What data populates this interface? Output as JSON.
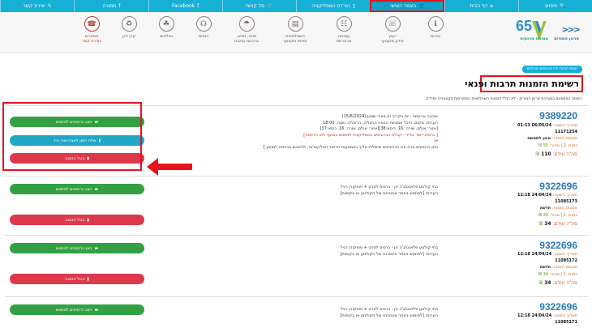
{
  "topbar": {
    "items": [
      {
        "label": "חיפוש",
        "icon": "search-icon",
        "glyph": "🔍"
      },
      {
        "label": "דף הבית",
        "icon": "home-icon",
        "glyph": "⌂"
      },
      {
        "label": "האזור האישי",
        "icon": "user-icon",
        "glyph": "👤"
      },
      {
        "label": "הורדת האפליקציה",
        "icon": "mobile-icon",
        "glyph": "▯"
      },
      {
        "label": "סל קניות",
        "icon": "cart-icon",
        "glyph": "🛒"
      },
      {
        "label": "Facebook",
        "icon": "facebook-icon",
        "glyph": "f"
      },
      {
        "label": "תמורה",
        "icon": "facebook-icon",
        "glyph": "f"
      },
      {
        "label": "יצירת קשר",
        "icon": "edit-icon",
        "glyph": "✎"
      }
    ]
  },
  "logo": {
    "years": "65",
    "arrows": "<<<",
    "org_name": "ארגון המורים",
    "org_tag": "עמותה מרגעית"
  },
  "nav": {
    "items": [
      {
        "label": "אודות",
        "glyph": "ℹ"
      },
      {
        "label": "ייעוץ\nמידע מקצועי",
        "glyph": "☏"
      },
      {
        "label": "עמותה\nפרוגרמת",
        "glyph": "☷"
      },
      {
        "label": "השתלמויות\nוסיומי מקצועי",
        "glyph": "▤"
      },
      {
        "label": "פנאי, נופש,\nצרכנות וביטוח",
        "glyph": "☂"
      },
      {
        "label": "כנסים",
        "glyph": "☊"
      },
      {
        "label": "גמלאים",
        "glyph": "☘"
      },
      {
        "label": "קרן ידע",
        "glyph": "♻"
      },
      {
        "label": "מספרים\nויצירת קשר",
        "glyph": "☎"
      }
    ]
  },
  "page": {
    "badge": "זמנת תכנות לפי מיוחסים מרכזיים",
    "title": "רשימת הזמנות תרבות ופנאי",
    "subtitle": "רשימה המוזמנים במערכת ארגון המורים - לא כולל הזמנות השתלמויות המפורסות בקטגוריה נפרדת."
  },
  "buttons": {
    "show": "הצג כרטיסים למימוש",
    "link": "שלח זימון לאנדרואיד נייד",
    "cancel": "בטל הזמנה"
  },
  "orders": [
    {
      "number": "9389220",
      "date_label": "תאריך הזמנה:",
      "date": "06/05/24 01:13",
      "booking_label": "שורה בהזמנה:",
      "booking": "11171254",
      "status_label": "סטטוס הזמנה:",
      "status": "מוכן לתמשה",
      "qty_label": "כמות: 2 | מחיר:",
      "price": "55",
      "total_label": "סה\"כ עולם:",
      "total": "110",
      "desc": [
        "אביבה ארגמוני - זת בקריה ות.באור שובע (15/6/2024)",
        "הערות: מקום: היכל אמנויות הבמה הרצליה, הרצליה, שעה: 18:00",
        "[אזור: אולם, שורה :16, כיסא:38][אזור: אולם, שורה :16, כיסא:37]",
        "[ כרטיס יישיר בנייד - קבלת הכרטיסים באפליקציה למימוש במועד לאו הדפסה]",
        "או",
        "ניתן כרטיסים בניה את הכרטיסים שישלוח אליך באמצעות הדואר האלקטרוני, ולהציגם בכניסה למופע ]"
      ]
    },
    {
      "number": "9322696",
      "date_label": "תאריך הזמנה:",
      "date": "24/04/24 12:18",
      "booking_label": "שורה בהזמנה:",
      "booking": "11085173",
      "status_label": "סטטוס הזמנה:",
      "status": "חדשה",
      "qty_label": "כמות: 1 | מחיר:",
      "price": "34",
      "total_label": "סה\"כ עולם:",
      "total": "34",
      "desc": [
        "בתי קולנוע פלאנט/ג'ה חן - כרטיס לסרט + פופקורן רגיל",
        "הערות: [למימוש באתר אינטרנט של הקולנוע או בקופות]"
      ]
    },
    {
      "number": "9322696",
      "date_label": "תאריך הזמנה:",
      "date": "24/04/24 12:18",
      "booking_label": "שורה בהזמנה:",
      "booking": "11085172",
      "status_label": "סטטוס הזמנה:",
      "status": "חדשה",
      "qty_label": "כמות: 1 | מחיר:",
      "price": "34",
      "total_label": "סה\"כ עולם:",
      "total": "34",
      "desc": [
        "בתי קולנוע פלאנט/ג'ה חן - כרטיס לסרט + פופקורן רגיל",
        "הערות: [למימוש באתר אינטרנט של הקולנוע או בקופות]"
      ]
    },
    {
      "number": "9322696",
      "date_label": "תאריך הזמנה:",
      "date": "24/04/24 12:18",
      "booking_label": "שורה בהזמנה:",
      "booking": "11085171",
      "status_label": "",
      "status": "",
      "qty_label": "",
      "price": "",
      "total_label": "",
      "total": "",
      "desc": [
        "בתי קולנוע פלאנט/ג'ה חן - כרטיס לסרט + פופקורן רגיל",
        "הערות: [למימוש באתר אינטרנט של הקולנוע או בקופות]"
      ]
    }
  ],
  "colors": {
    "topbar": "#16b0d6",
    "highlight": "#e8121e",
    "btn_green": "#33a143",
    "btn_blue": "#1fa7c7",
    "btn_red": "#dc3a4c",
    "order_number": "#2a7bbf"
  }
}
